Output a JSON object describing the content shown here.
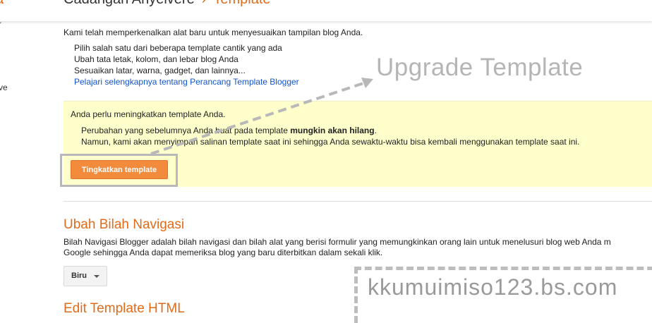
{
  "header": {
    "left_fragment": "a",
    "blog_name": "Cadangan Anyelvere",
    "separator": "›",
    "current_page": "Template"
  },
  "sidebar_fragments": [
    "r",
    "ve"
  ],
  "intro": {
    "heading": "Kami telah memperkenalkan alat baru untuk menyesuaikan tampilan blog Anda.",
    "lines": [
      "Pilih salah satu dari beberapa template cantik yang ada",
      "Ubah tata letak, kolom, dan lebar blog Anda",
      "Sesuaikan latar, warna, gadget, dan lainnya..."
    ],
    "link": "Pelajari selengkapnya tentang Perancang Template Blogger"
  },
  "callout": {
    "text": "Upgrade Template"
  },
  "notice": {
    "title": "Anda perlu meningkatkan template Anda.",
    "line1_pre": "Perubahan yang sebelumnya Anda buat pada template ",
    "line1_bold": "mungkin akan hilang",
    "line1_post": ".",
    "line2": "Namun, kami akan menyimpan salinan template saat ini sehingga Anda sewaktu-waktu bisa kembali menggunakan template saat ini.",
    "button_label": "Tingkatkan template"
  },
  "navbar_section": {
    "title": "Ubah Bilah Navigasi",
    "desc_line1": "Bilah Navigasi Blogger adalah bilah navigasi dan bilah alat yang berisi formulir yang memungkinkan orang lain untuk menelusuri blog web Anda m",
    "desc_line2": "Google sehingga Anda dapat memeriksa blog yang baru diterbitkan dalam sekali klik.",
    "dropdown_value": "Biru"
  },
  "html_section": {
    "title": "Edit Template HTML"
  },
  "watermark": {
    "text": "kkumuimiso123.bs.com"
  },
  "colors": {
    "accent": "#e26b1a",
    "button": "#f28b3c",
    "notice_bg": "#ffffcc",
    "link": "#1155cc"
  }
}
